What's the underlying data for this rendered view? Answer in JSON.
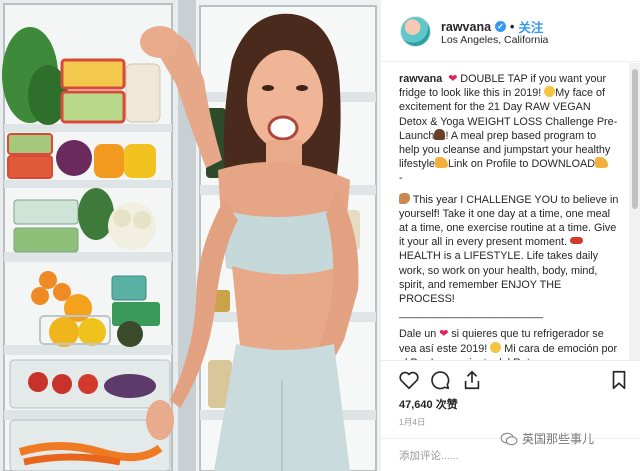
{
  "post": {
    "username": "rawvana",
    "verified_icon": "verified-badge-icon",
    "separator": "•",
    "follow_label": "关注",
    "location": "Los Angeles, California",
    "avatar_icon": "profile-avatar"
  },
  "caption": {
    "username": "rawvana",
    "p1_a": "DOUBLE TAP if you want your fridge to look like this in 2019!",
    "p1_b": "My face of excitement for the 21 Day RAW VEGAN Detox & Yoga WEIGHT LOSS Challenge Pre-Launch",
    "p1_c": "! A meal prep based program to help you cleanse and jumpstart your healthy lifestyle",
    "p1_d": "Link on Profile to DOWNLOAD",
    "p2_dash": "-",
    "p3_a": "This year I CHALLENGE YOU to believe in yourself! Take it one day at a time, one meal at a time, one exercise routine at a time. Give it your all in every present moment.",
    "p3_b": "HEALTH is a LIFESTYLE. Life takes daily work, so work on your health, body, mind, spirit, and remember ENJOY THE PROCESS!",
    "p4_rule": "________________________",
    "p5_a": "Dale un",
    "p5_b": "si quieres que tu refrigerador se vea así este 2019!",
    "p5_c": "Mi cara de emoción por el Pre-Lanzamiento del Reto"
  },
  "actions": {
    "like_icon": "heart-icon",
    "comment_icon": "comment-icon",
    "share_icon": "share-icon",
    "save_icon": "bookmark-icon",
    "likes_count": "47,640",
    "likes_label": "次赞",
    "date": "1月4日"
  },
  "comment": {
    "placeholder": "添加评论......"
  },
  "watermark": {
    "text": "英国那些事儿",
    "icon": "wechat-icon"
  },
  "colors": {
    "accent_blue": "#3897f0",
    "heart_red": "#e0245e",
    "muted_gray": "#999999",
    "text": "#262626"
  }
}
